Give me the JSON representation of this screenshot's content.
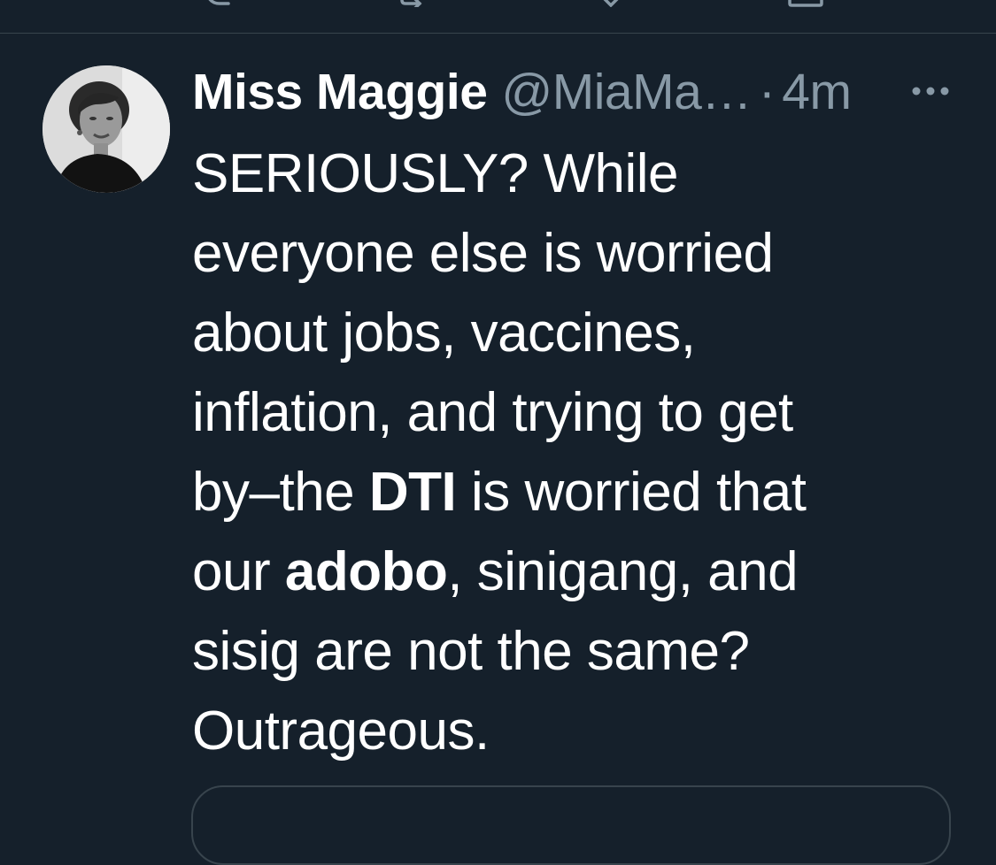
{
  "prev_tweet_actions": {
    "icons": [
      "reply-icon",
      "retweet-icon",
      "like-icon",
      "share-icon"
    ]
  },
  "tweet": {
    "display_name": "Miss Maggie",
    "handle": "@MiaMa…",
    "separator": "·",
    "timestamp": "4m",
    "more_icon": "more-dots-icon",
    "body": {
      "line1": "SERIOUSLY? While",
      "line2": "everyone else is worried",
      "line3": "about jobs, vaccines,",
      "line4": "inflation, and trying to get",
      "line5_pre": "by–the ",
      "line5_bold": "DTI",
      "line5_post": " is worried that",
      "line6_pre": "our ",
      "line6_bold": "adobo",
      "line6_post": ", sinigang, and",
      "line7": "sisig are not the same?",
      "line8": "Outrageous."
    }
  },
  "colors": {
    "background": "#15202b",
    "text": "#ffffff",
    "secondary_text": "#8899a6",
    "border": "#38444d"
  }
}
